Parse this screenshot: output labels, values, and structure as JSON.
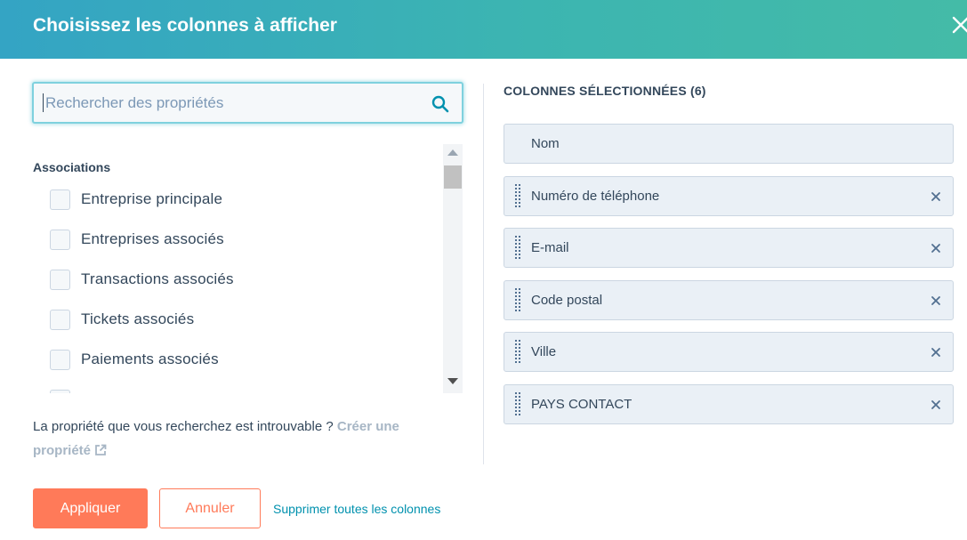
{
  "header": {
    "title": "Choisissez les colonnes à afficher",
    "close_icon": "close-icon"
  },
  "search": {
    "placeholder": "Rechercher des propriétés",
    "value": "",
    "icon": "search-icon"
  },
  "property_list": {
    "group_label": "Associations",
    "options": [
      {
        "label": "Entreprise principale",
        "checked": false
      },
      {
        "label": "Entreprises associés",
        "checked": false
      },
      {
        "label": "Transactions associés",
        "checked": false
      },
      {
        "label": "Tickets associés",
        "checked": false
      },
      {
        "label": "Paiements associés",
        "checked": false
      }
    ]
  },
  "not_found": {
    "text": "La propriété que vous recherchez est introuvable ? ",
    "link": "Créer une propriété",
    "link_icon": "external-link-icon"
  },
  "selected": {
    "title": "COLONNES SÉLECTIONNÉES (6)",
    "columns": [
      {
        "label": "Nom",
        "removable": false
      },
      {
        "label": "Numéro de téléphone",
        "removable": true
      },
      {
        "label": "E-mail",
        "removable": true
      },
      {
        "label": "Code postal",
        "removable": true
      },
      {
        "label": "Ville",
        "removable": true
      },
      {
        "label": "PAYS CONTACT",
        "removable": true
      }
    ]
  },
  "footer": {
    "apply_label": "Appliquer",
    "cancel_label": "Annuler",
    "remove_all_label": "Supprimer toutes les colonnes"
  },
  "colors": {
    "header_gradient_start": "#34a4c4",
    "header_gradient_end": "#44bba7",
    "primary_button": "#ff7a59",
    "link": "#0091ae",
    "text": "#33475b"
  }
}
